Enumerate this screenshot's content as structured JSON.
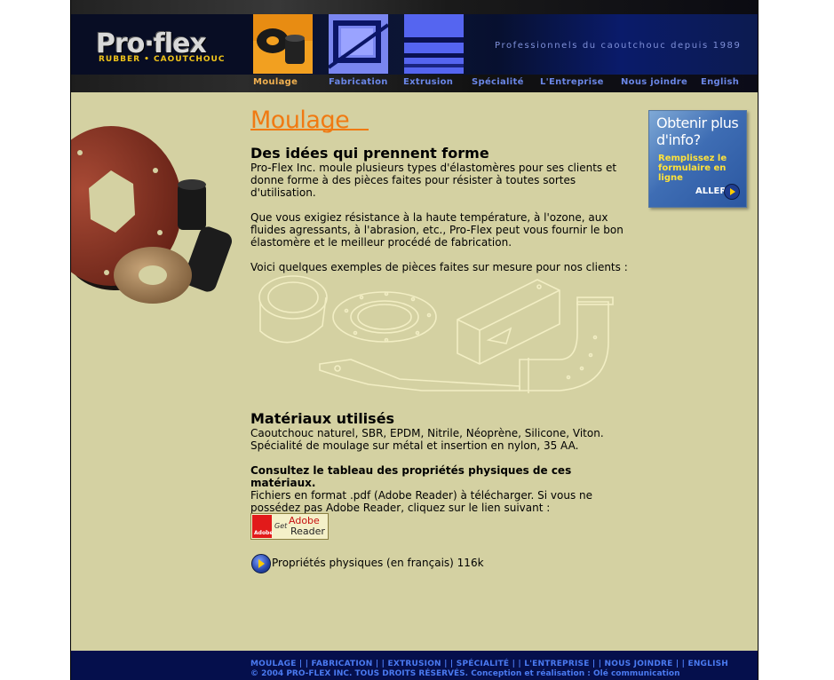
{
  "header": {
    "logo_text": "Pro·flex",
    "logo_subtitle": "RUBBER • CAOUTCHOUC",
    "tagline": "Professionnels du caoutchouc depuis 1989"
  },
  "nav": {
    "items": [
      {
        "label": "Moulage",
        "active": true
      },
      {
        "label": "Fabrication",
        "active": false
      },
      {
        "label": "Extrusion",
        "active": false
      },
      {
        "label": "Spécialité",
        "active": false
      },
      {
        "label": "L'Entreprise",
        "active": false
      },
      {
        "label": "Nous joindre",
        "active": false
      },
      {
        "label": "English",
        "active": false
      }
    ]
  },
  "main": {
    "page_title": "Moulage",
    "section1": {
      "heading": "Des idées qui prennent forme",
      "para1": "Pro-Flex Inc. moule plusieurs types d'élastomères pour ses clients et donne forme à des pièces faites pour résister à toutes sortes d'utilisation.",
      "para2": "Que vous exigiez résistance à la haute température, à l'ozone, aux fluides agressants, à l'abrasion, etc., Pro-Flex peut vous fournir le bon élastomère et le meilleur procédé de fabrication.",
      "para3": "Voici quelques exemples de pièces faites sur mesure pour nos clients :"
    },
    "section2": {
      "heading": "Matériaux utilisés",
      "para1": "Caoutchouc naturel, SBR, EPDM, Nitrile, Néoprène, Silicone, Viton. Spécialité de moulage sur métal et insertion en nylon, 35 AA.",
      "bold_line": "Consultez le tableau des propriétés physiques de ces matériaux.",
      "para2": "Fichiers en format .pdf (Adobe Reader) à télécharger. Si vous ne possédez pas Adobe Reader, cliquez sur le lien suivant :"
    },
    "adobe_badge": {
      "get": "Get",
      "brand_top": "Adobe",
      "brand_bottom": "Reader",
      "logo_word": "Adobe"
    },
    "pdf_link": "Propriétés physiques (en français) 116k"
  },
  "promo": {
    "title": "Obtenir plus d'info?",
    "subtitle": "Remplissez le formulaire en ligne",
    "go": "ALLER"
  },
  "footer": {
    "links": [
      "MOULAGE",
      "FABRICATION",
      "EXTRUSION",
      "SPÉCIALITÉ",
      "L'ENTREPRISE",
      "NOUS JOINDRE",
      "ENGLISH"
    ],
    "separator": " | | ",
    "copyright": "© 2004 PRO-FLEX INC. TOUS DROITS RÉSERVÉS. Conception et réalisation : Olé communication"
  },
  "colors": {
    "page_bg": "#d4d1a2",
    "title_orange": "#f07a12",
    "nav_active": "#f0b050",
    "nav_link": "#6a86e6",
    "footer_bg": "#050f4c",
    "footer_link": "#4a7af0"
  }
}
